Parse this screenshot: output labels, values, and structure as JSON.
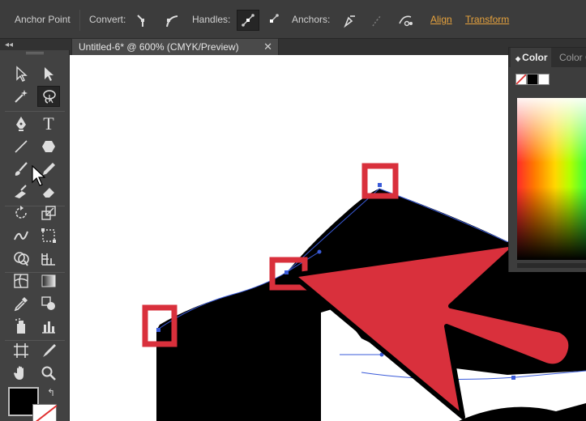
{
  "control_bar": {
    "tool_name": "Anchor Point",
    "convert_label": "Convert:",
    "handles_label": "Handles:",
    "anchors_label": "Anchors:",
    "align_link": "Align",
    "transform_link": "Transform"
  },
  "document": {
    "tab_title": "Untitled-6* @ 600% (CMYK/Preview)",
    "close_symbol": "✕"
  },
  "tools_panel": {
    "collapse_symbol": "◂◂",
    "type_tool_glyph": "T",
    "swap_symbol": "↰"
  },
  "color_panel": {
    "active_tab": "Color",
    "inactive_tab": "Color Guide",
    "tab_arrows": "◆"
  },
  "colors": {
    "highlight_red": "#d9303c",
    "accent_orange": "#e8a33d",
    "path_blue": "#3a5bd9"
  }
}
